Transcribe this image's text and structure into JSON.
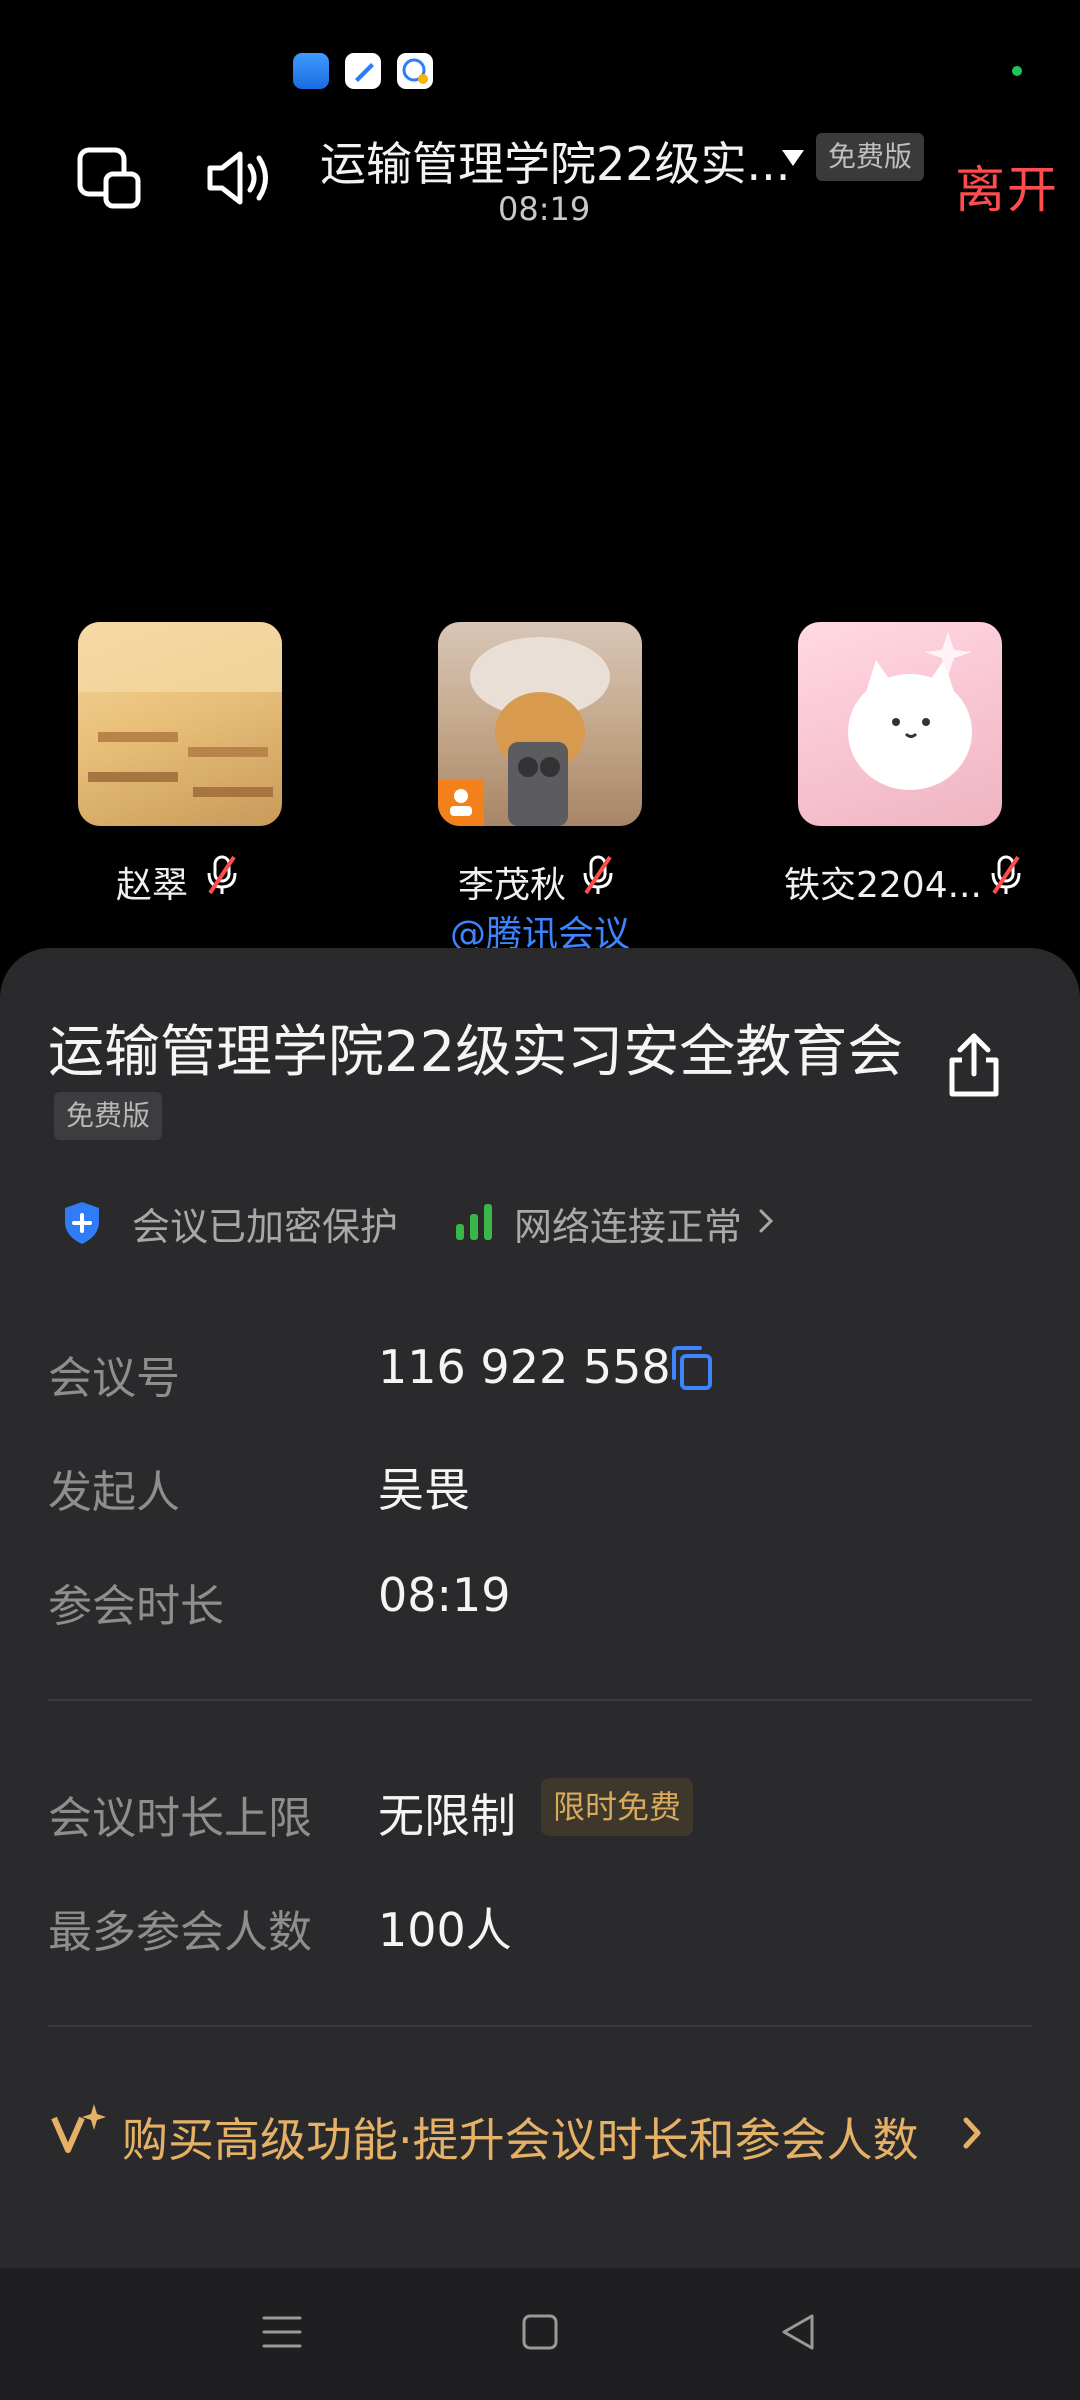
{
  "status_bar": {
    "app_icons": [
      "app-icon-blue",
      "app-icon-notes",
      "app-icon-chat"
    ],
    "indicator_color": "#21c45a"
  },
  "top_bar": {
    "title": "运输管理学院22级实...",
    "badge": "免费版",
    "leave_label": "离开",
    "elapsed": "08:19"
  },
  "participants": [
    {
      "name": "赵翠",
      "muted": true
    },
    {
      "name": "李茂秋",
      "muted": true
    },
    {
      "name": "铁交2204...",
      "muted": true
    }
  ],
  "watermark": "@腾讯会议",
  "sheet": {
    "title": "运输管理学院22级实习安全教育会",
    "badge": "免费版",
    "encryption": "会议已加密保护",
    "network": "网络连接正常",
    "info": {
      "meeting_id_label": "会议号",
      "meeting_id": "116 922 558",
      "host_label": "发起人",
      "host": "吴畏",
      "duration_label": "参会时长",
      "duration": "08:19",
      "limit_label": "会议时长上限",
      "limit": "无限制",
      "limit_badge": "限时免费",
      "max_label": "最多参会人数",
      "max": "100人"
    },
    "promo": "购买高级功能·提升会议时长和参会人数"
  },
  "colors": {
    "leave": "#ff4d4f",
    "link": "#3d84ff",
    "gold": "#e4b166"
  }
}
